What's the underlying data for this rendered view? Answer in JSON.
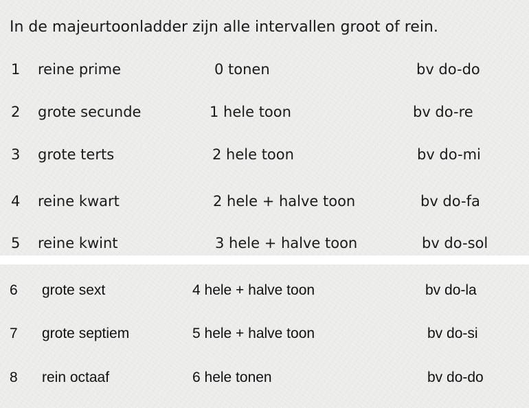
{
  "heading": "In de majeurtoonladder zijn alle intervallen groot of rein.",
  "top_rows": [
    {
      "num": "1",
      "name": "reine prime",
      "steps": "0 tonen",
      "example": "bv do-do"
    },
    {
      "num": "2",
      "name": "grote secunde",
      "steps": "1 hele toon",
      "example": "bv do-re"
    },
    {
      "num": "3",
      "name": "grote terts",
      "steps": "2 hele toon",
      "example": "bv do-mi"
    },
    {
      "num": "4",
      "name": "reine kwart",
      "steps": "2 hele + halve toon",
      "example": "bv do-fa"
    },
    {
      "num": "5",
      "name": "reine kwint",
      "steps": "3 hele + halve toon",
      "example": "bv do-sol"
    }
  ],
  "bottom_rows": [
    {
      "num": "6",
      "name": "grote sext",
      "steps": "4 hele + halve toon",
      "example": "bv do-la"
    },
    {
      "num": "7",
      "name": "grote septiem",
      "steps": "5 hele + halve toon",
      "example": "bv do-si"
    },
    {
      "num": "8",
      "name": "rein octaaf",
      "steps": "6 hele tonen",
      "example": "bv do-do"
    }
  ]
}
